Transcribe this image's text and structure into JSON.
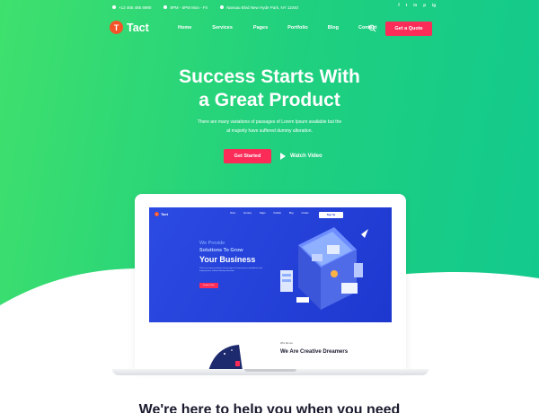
{
  "colors": {
    "accent": "#fb2c58",
    "hero_start": "#3fe06d",
    "hero_end": "#12c98f",
    "screen_blue": "#1d38cf"
  },
  "topbar": {
    "phone": "+12 465 485 6990",
    "hours": "8PM - 5PM Mon - Fri",
    "address": "Nassau Blvd New Hyde Park, NY 11040",
    "socials": [
      "f",
      "t",
      "in",
      "p",
      "ig"
    ]
  },
  "nav": {
    "logo_letter": "T",
    "logo_text": "Tact",
    "items": [
      "Home",
      "Services",
      "Pages",
      "Portfolio",
      "Blog",
      "Contact"
    ],
    "quote_button": "Get a Quote"
  },
  "hero": {
    "title_line1": "Success Starts With",
    "title_line2": "a Great Product",
    "desc_line1": "There are many variations of passages of Lorem Ipsum available but the",
    "desc_line2": "at majority have suffered dummy alteration.",
    "get_started": "Get Started",
    "watch_video": "Watch Video"
  },
  "mockup": {
    "logo_letter": "T",
    "logo_text": "Tact",
    "menu": [
      "Home",
      "Services",
      "Pages",
      "Portfolio",
      "Blog",
      "Contact"
    ],
    "signup": "Sign Up",
    "line1": "We Provide",
    "line2": "Solutions To Grow",
    "line3": "Your Business",
    "desc": "There are many variations of passages of Lorem Ipsum available but the majority have suffered dummy alteration.",
    "cta": "Explore Now",
    "who_label": "Who We Are",
    "who_title": "We Are Creative Dreamers"
  },
  "bottom": {
    "heading": "We're here to help you when you need"
  }
}
